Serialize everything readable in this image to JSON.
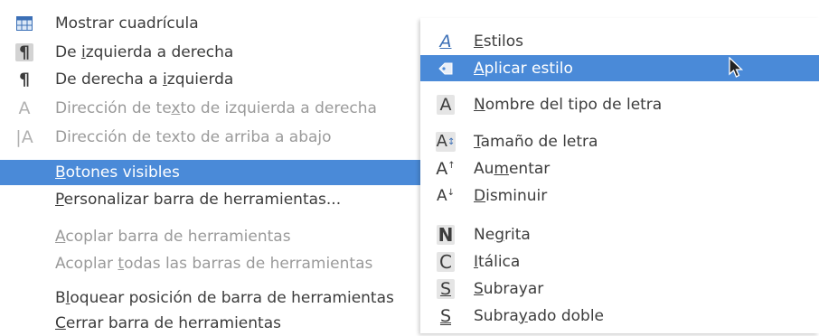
{
  "left_menu": {
    "items": [
      {
        "pre": "",
        "u": "",
        "post": "Mostrar cuadrícula",
        "disabled": false
      },
      {
        "pre": "De ",
        "u": "i",
        "post": "zquierda a derecha",
        "disabled": false
      },
      {
        "pre": "De derecha a ",
        "u": "i",
        "post": "zquierda",
        "disabled": false
      },
      {
        "pre": "Dirección de te",
        "u": "x",
        "post": "to de izquierda a derecha",
        "disabled": true
      },
      {
        "pre": "Dirección de texto de arriba a abajo",
        "u": "",
        "post": "",
        "disabled": true
      },
      {
        "pre": "",
        "u": "B",
        "post": "otones visibles",
        "disabled": false,
        "highlighted": true
      },
      {
        "pre": "",
        "u": "P",
        "post": "ersonalizar barra de herramientas...",
        "disabled": false
      },
      {
        "pre": "",
        "u": "A",
        "post": "coplar barra de herramientas",
        "disabled": true
      },
      {
        "pre": "Acoplar ",
        "u": "t",
        "post": "odas las barras de herramientas",
        "disabled": true
      },
      {
        "pre": "B",
        "u": "l",
        "post": "oquear posición de barra de herramientas",
        "disabled": false
      },
      {
        "pre": "",
        "u": "C",
        "post": "errar barra de herramientas",
        "disabled": false
      }
    ]
  },
  "right_menu": {
    "items": [
      {
        "pre": "",
        "u": "E",
        "post": "stilos",
        "icon": "styles-icon"
      },
      {
        "pre": "",
        "u": "A",
        "post": "plicar estilo",
        "icon": "apply-style-icon",
        "highlighted": true
      },
      {
        "pre": "",
        "u": "N",
        "post": "ombre del tipo de letra",
        "icon": "font-name-icon"
      },
      {
        "pre": "",
        "u": "T",
        "post": "amaño de letra",
        "icon": "font-size-icon"
      },
      {
        "pre": "Au",
        "u": "m",
        "post": "entar",
        "icon": "grow-font-icon"
      },
      {
        "pre": "",
        "u": "D",
        "post": "isminuir",
        "icon": "shrink-font-icon"
      },
      {
        "pre": "Ne",
        "u": "g",
        "post": "rita",
        "icon": "bold-icon"
      },
      {
        "pre": "",
        "u": "I",
        "post": "tálica",
        "icon": "italic-icon"
      },
      {
        "pre": "",
        "u": "S",
        "post": "ubrayar",
        "icon": "underline-icon"
      },
      {
        "pre": "Subra",
        "u": "y",
        "post": "ado doble",
        "icon": "double-underline-icon"
      }
    ]
  },
  "colors": {
    "highlight": "#4a8ad8",
    "text": "#3c3c3c",
    "disabled": "#9a9a9a"
  }
}
